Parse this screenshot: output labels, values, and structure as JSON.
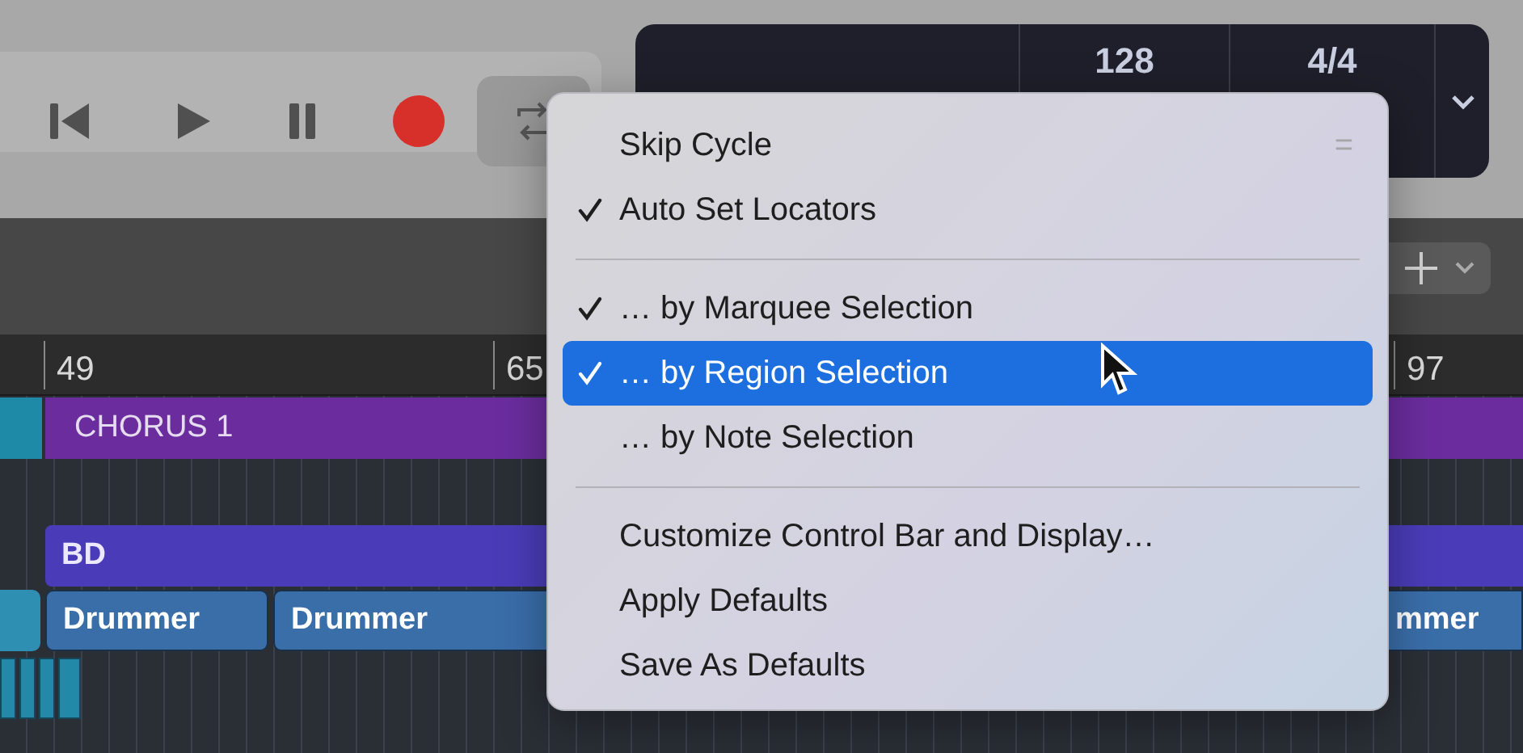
{
  "display": {
    "tempo": "128",
    "signature": "4/4"
  },
  "ruler": [
    "49",
    "65",
    "97"
  ],
  "regions": {
    "chorus": "CHORUS 1",
    "bd": "BD",
    "drummers": [
      "Drummer",
      "Drummer",
      "mmer"
    ]
  },
  "menu": [
    {
      "kind": "item",
      "label": "Skip Cycle",
      "checked": false,
      "selected": false,
      "shortcut": "="
    },
    {
      "kind": "item",
      "label": "Auto Set Locators",
      "checked": true,
      "selected": false
    },
    {
      "kind": "separator"
    },
    {
      "kind": "item",
      "label": "… by Marquee Selection",
      "checked": true,
      "selected": false
    },
    {
      "kind": "item",
      "label": "… by Region Selection",
      "checked": true,
      "selected": true
    },
    {
      "kind": "item",
      "label": "… by Note Selection",
      "checked": false,
      "selected": false
    },
    {
      "kind": "separator"
    },
    {
      "kind": "item",
      "label": "Customize Control Bar and Display…",
      "checked": false,
      "selected": false
    },
    {
      "kind": "item",
      "label": "Apply Defaults",
      "checked": false,
      "selected": false
    },
    {
      "kind": "item",
      "label": "Save As Defaults",
      "checked": false,
      "selected": false
    }
  ]
}
